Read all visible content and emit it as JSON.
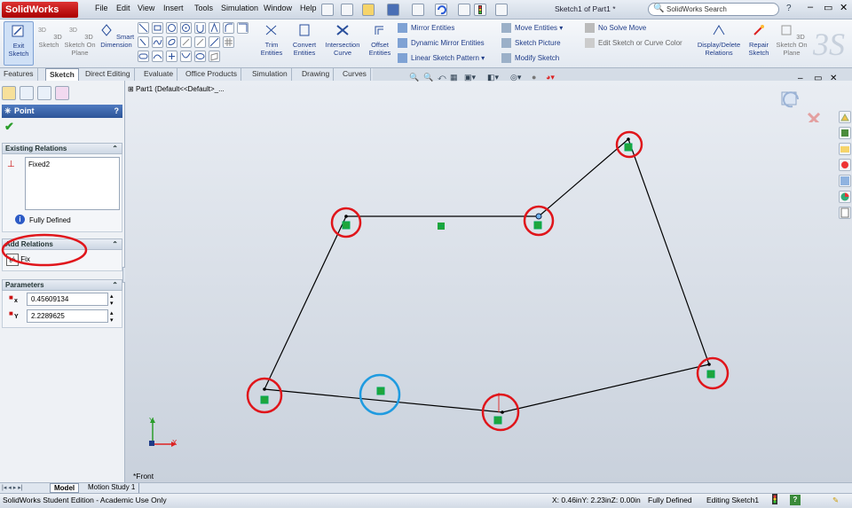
{
  "app": {
    "logo_text": "SolidWorks",
    "document_title": "Sketch1 of Part1 *",
    "menus": [
      "File",
      "Edit",
      "View",
      "Insert",
      "Tools",
      "Simulation",
      "Window",
      "Help"
    ],
    "search_placeholder": "SolidWorks Search",
    "help_label": "?",
    "window_buttons": [
      "–",
      "▭",
      "✕"
    ]
  },
  "commands": {
    "exit_sketch": "Exit Sketch",
    "sketch_3d": "3D Sketch",
    "sketch_3d_on_plane": "3D Sketch On Plane",
    "smart_dimension": "Smart Dimension",
    "trim_entities": "Trim Entities",
    "convert_entities": "Convert Entities",
    "intersection_curve": "Intersection Curve",
    "offset_entities": "Offset Entities",
    "mirror_entities": "Mirror Entities",
    "dynamic_mirror_entities": "Dynamic Mirror Entities",
    "linear_sketch_pattern": "Linear Sketch Pattern",
    "move_entities": "Move Entities",
    "sketch_picture": "Sketch Picture",
    "modify_sketch": "Modify Sketch",
    "no_solve_move": "No Solve Move",
    "edit_sketch_color": "Edit Sketch or Curve Color",
    "display_delete_relations": "Display/Delete Relations",
    "repair_sketch": "Repair Sketch",
    "sketch_3d_on_plane_right": "3D Sketch On Plane"
  },
  "tabs": [
    "Features",
    "Sketch",
    "Direct Editing",
    "Evaluate",
    "Office Products",
    "Simulation",
    "Drawing",
    "Curves"
  ],
  "active_tab": "Sketch",
  "property_manager": {
    "title": "Point",
    "help": "?",
    "existing_relations": {
      "header": "Existing Relations",
      "items": [
        "Fixed2"
      ],
      "status": "Fully Defined"
    },
    "add_relations": {
      "header": "Add Relations",
      "items": [
        "Fix"
      ]
    },
    "parameters": {
      "header": "Parameters",
      "x_label": "x",
      "x_value": "0.45609134",
      "y_label": "Y",
      "y_value": "2.2289625"
    }
  },
  "canvas": {
    "tree_label": "Part1  (Default<<Default>_...",
    "view_label": "*Front",
    "axis_x": "X",
    "axis_y": "Y"
  },
  "bottom_tabs": [
    "Model",
    "Motion Study 1"
  ],
  "status": {
    "edition": "SolidWorks Student Edition - Academic Use Only",
    "coords": "X: 0.46inY: 2.23inZ: 0.00in",
    "defined": "Fully Defined",
    "editing": "Editing Sketch1"
  },
  "colors": {
    "annotation_red": "#e0151b",
    "annotation_blue": "#1f9be0",
    "relation_green": "#1fa53b",
    "accent": "#1f3c88"
  }
}
